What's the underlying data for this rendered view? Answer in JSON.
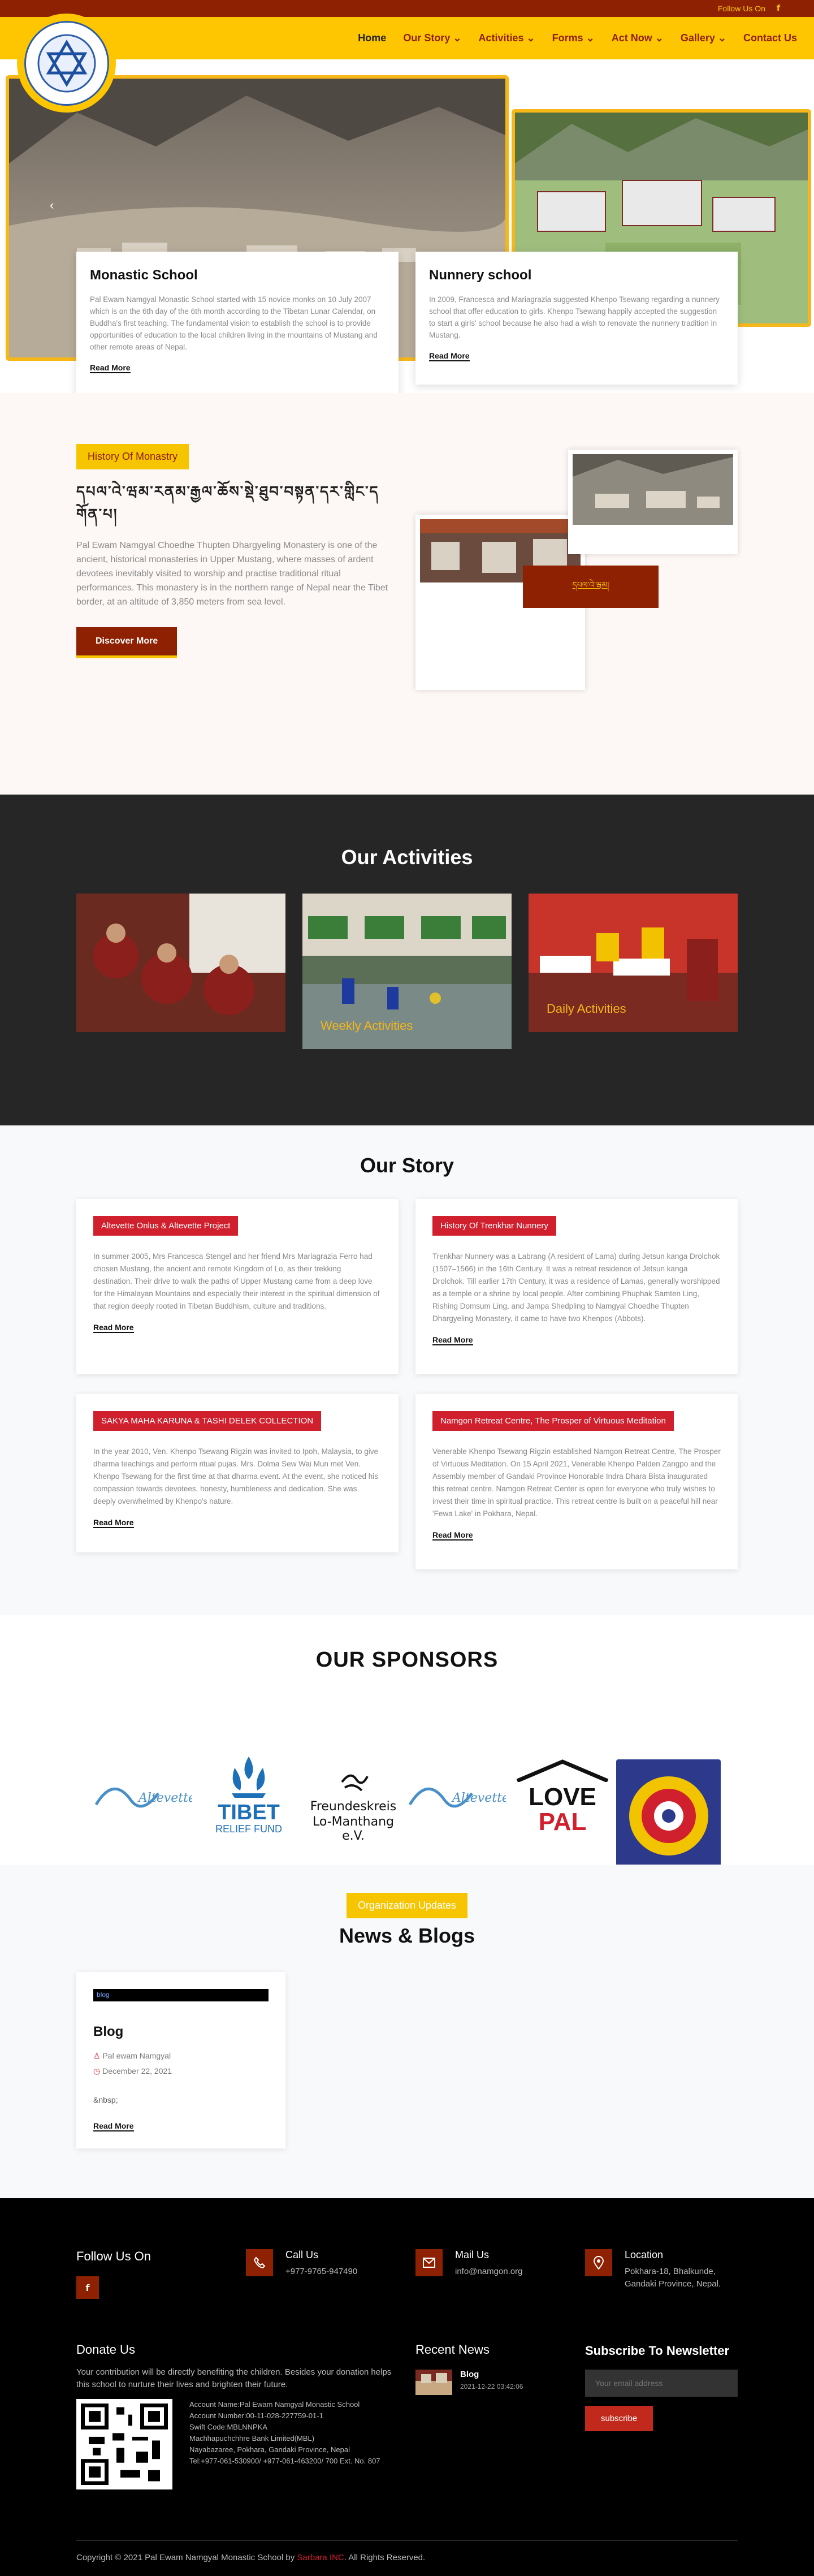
{
  "topbar": {
    "follow": "Follow Us On",
    "fb": "f"
  },
  "nav": {
    "items": [
      "Home",
      "Our Story",
      "Activities",
      "Forms",
      "Act Now",
      "Gallery",
      "Contact Us"
    ]
  },
  "hero": {
    "arrow": "‹",
    "card1": {
      "title": "Monastic School",
      "text": "Pal Ewam Namgyal Monastic School started with 15 novice monks on 10 July 2007 which is on the 6th day of the 6th month according to the Tibetan Lunar Calendar, on Buddha's first teaching. The fundamental vision to establish the school is to provide opportunities of education to the local children living in the mountains of Mustang and other remote areas of Nepal.",
      "link": "Read More"
    },
    "card2": {
      "title": "Nunnery school",
      "text": "In 2009, Francesca and Mariagrazia suggested Khenpo Tsewang regarding a nunnery school that offer education to girls. Khenpo Tsewang happily accepted the suggestion to start a girls' school because he also had a wish to renovate the nunnery tradition in Mustang.",
      "link": "Read More"
    }
  },
  "history": {
    "tag": "History Of Monastry",
    "title": "དཔལ་འེ་ཝམ་རནམ་རྒྱལ་ཆོས་སྡེ་ཐུབ་བསྟན་དར་གླིང་དགོན་པ།",
    "text": "Pal Ewam Namgyal Choedhe Thupten Dhargyeling Monastery is one of the ancient, historical monasteries in Upper Mustang, where masses of ardent devotees inevitably visited to worship and practise traditional ritual performances. This monastery is in the northern range of Nepal near the Tibet border, at an altitude of 3,850 meters from sea level.",
    "button": "Discover More",
    "redbox": "དཔལ་འེ་ཝམ།"
  },
  "activities": {
    "title": "Our Activities",
    "items": [
      "",
      "Weekly Activities",
      "Daily Activities"
    ]
  },
  "story": {
    "title": "Our Story",
    "cards": [
      {
        "tag": "Altevette Onlus & Altevette Project",
        "text": "In summer 2005, Mrs Francesca Stengel and her friend Mrs Mariagrazia Ferro had chosen Mustang, the ancient and remote Kingdom of Lo, as their trekking destination. Their drive to walk the paths of Upper Mustang came from a deep love for the Himalayan Mountains and especially their interest in the spiritual dimension of that region deeply rooted in Tibetan Buddhism, culture and traditions.",
        "link": "Read More"
      },
      {
        "tag": "History Of Trenkhar Nunnery",
        "text": "Trenkhar Nunnery was a Labrang (A resident of Lama) during Jetsun kanga Drolchok (1507–1566) in the 16th Century. It was a retreat residence of Jetsun kanga Drolchok. Till earlier 17th Century, it was a residence of Lamas, generally worshipped as a temple or a shrine by local people. After combining Phuphak Samten Ling, Rishing Domsum Ling, and Jampa Shedpling to Namgyal Choedhe Thupten Dhargyeling Monastery, it came to have two Khenpos (Abbots).",
        "link": "Read More"
      },
      {
        "tag": "SAKYA MAHA KARUNA & TASHI DELEK COLLECTION",
        "text": "In the year 2010, Ven. Khenpo Tsewang Rigzin was invited to Ipoh, Malaysia, to give dharma teachings and perform ritual pujas. Mrs. Dolma Sew Wai Mun met Ven. Khenpo Tsewang for the first time at that dharma event. At the event, she noticed his compassion towards devotees, honesty, humbleness and dedication. She was deeply overwhelmed by Khenpo's nature.",
        "link": "Read More"
      },
      {
        "tag": "Namgon Retreat Centre, The Prosper of Virtuous Meditation",
        "text": "Venerable Khenpo Tsewang Rigzin established Namgon Retreat Centre, The Prosper of Virtuous Meditation. On 15 April 2021, Venerable Khenpo Palden Zangpo and the Assembly member of Gandaki Province Honorable Indra Dhara Bista inaugurated this retreat centre. Namgon Retreat Center is open for everyone who truly wishes to invest their time in spiritual practice. This retreat centre is built on a peaceful hill near 'Fewa Lake' in Pokhara, Nepal.",
        "link": "Read More"
      }
    ]
  },
  "sponsors": {
    "title": "OUR SPONSORS",
    "s1": "Altevette",
    "s2a": "TIBET",
    "s2b": "RELIEF FUND",
    "s3a": "Freundeskreis",
    "s3b": "Lo-Manthang e.V.",
    "s4": "Altevette",
    "s5a": "LOVE",
    "s5b": "PAL"
  },
  "news": {
    "tag": "Organization Updates",
    "title": "News & Blogs",
    "img_alt": "blog",
    "post": {
      "title": "Blog",
      "author": "Pal ewam Namgyal",
      "date": "December 22, 2021",
      "excerpt": "&nbsp;",
      "link": "Read More"
    }
  },
  "footer": {
    "follow": "Follow Us On",
    "fb": "f",
    "call": {
      "title": "Call Us",
      "value": "+977-9765-947490"
    },
    "mail": {
      "title": "Mail Us",
      "value": "info@namgon.org"
    },
    "location": {
      "title": "Location",
      "value": "Pokhara-18, Bhalkunde, Gandaki Province, Nepal."
    },
    "donate": {
      "title": "Donate Us",
      "text": "Your contribution will be directly benefiting the children. Besides your donation helps this school to nurture their lives and brighten their future.",
      "bank": [
        "Account Name:Pal Ewam Namgyal Monastic School",
        "Account Number:00-11-028-227759-01-1",
        "Swift Code:MBLNNPKA",
        "Machhapuchchhre Bank Limited(MBL)",
        "Nayabazaree, Pokhara, Gandaki Province, Nepal",
        "Tel:+977-061-530900/ +977-061-463200/ 700 Ext. No. 807"
      ]
    },
    "recent": {
      "title": "Recent News",
      "item": "Blog",
      "date": "2021-12-22 03:42:06"
    },
    "subscribe": {
      "title": "Subscribe To Newsletter",
      "placeholder": "Your email address",
      "button": "subscribe"
    },
    "copy_pre": "Copyright © 2021 Pal Ewam Namgyal Monastic School by ",
    "copy_brand": "Sarbara INC",
    "copy_post": ". All Rights Reserved."
  }
}
